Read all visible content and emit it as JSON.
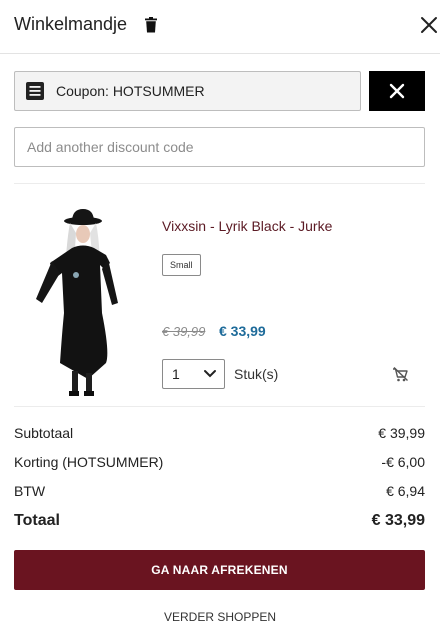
{
  "header": {
    "title": "Winkelmandje",
    "trash_icon": "trash-icon",
    "close_icon": "close-icon"
  },
  "coupon": {
    "label": "Coupon: HOTSUMMER",
    "icon": "coupon-list-icon",
    "remove_icon": "close-icon"
  },
  "discount": {
    "placeholder": "Add another discount code",
    "value": ""
  },
  "product": {
    "name": "Vixxsin - Lyrik Black - Jurke",
    "size": "Small",
    "price_old": "€ 39,99",
    "price_new": "€ 33,99",
    "quantity": "1",
    "unit": "Stuk(s)",
    "remove_icon": "remove-from-cart-icon"
  },
  "summary": {
    "subtotal_label": "Subtotaal",
    "subtotal_value": "€ 39,99",
    "discount_label": "Korting (HOTSUMMER)",
    "discount_value": "-€ 6,00",
    "tax_label": "BTW",
    "tax_value": "€ 6,94",
    "total_label": "Totaal",
    "total_value": "€ 33,99"
  },
  "actions": {
    "checkout": "GA NAAR AFREKENEN",
    "continue": "VERDER SHOPPEN"
  },
  "colors": {
    "accent": "#6a1420",
    "price": "#1e6b9a",
    "product_name": "#5b1a24"
  }
}
